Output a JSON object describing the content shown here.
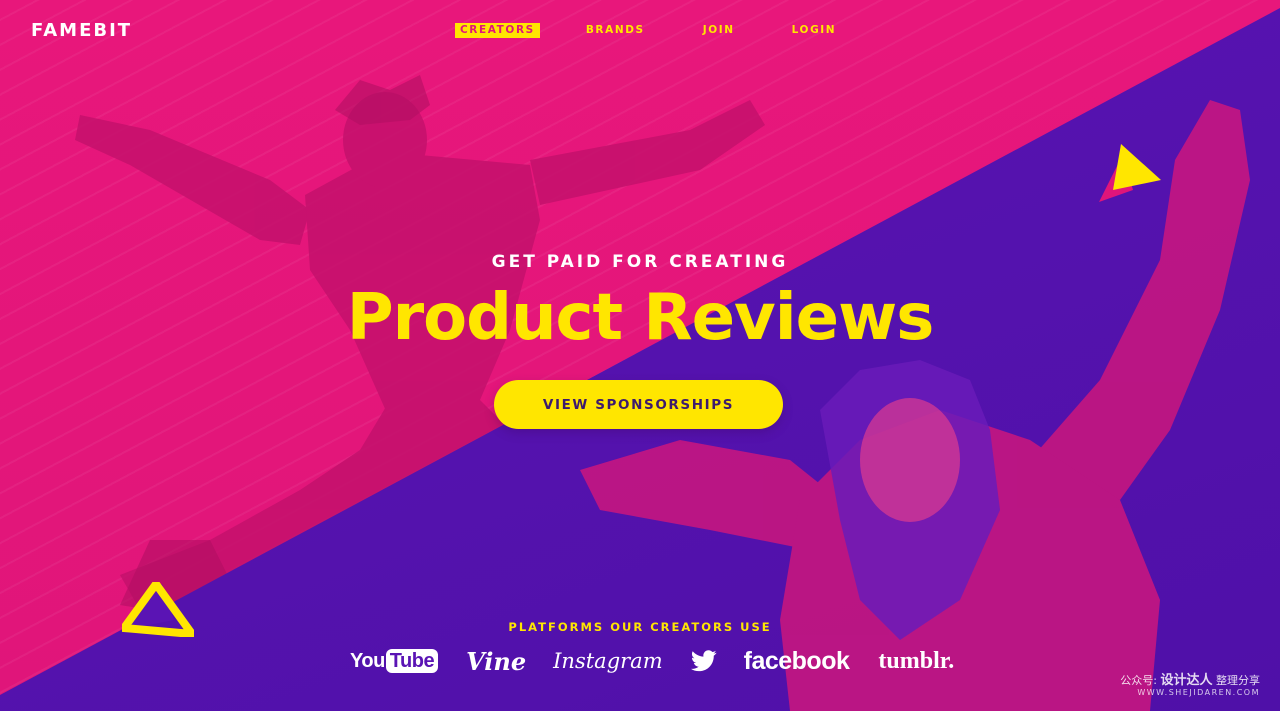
{
  "brand": {
    "logo_text": "FAMEBIT"
  },
  "nav": {
    "items": [
      {
        "label": "CREATORS",
        "active": true
      },
      {
        "label": "BRANDS",
        "active": false
      },
      {
        "label": "JOIN",
        "active": false
      },
      {
        "label": "LOGIN",
        "active": false
      }
    ]
  },
  "hero": {
    "kicker": "GET PAID FOR CREATING",
    "headline": "Product Reviews",
    "cta_label": "VIEW SPONSORSHIPS"
  },
  "platforms": {
    "title": "PLATFORMS OUR CREATORS USE",
    "youtube_you": "You",
    "youtube_tube": "Tube",
    "vine": "Vine",
    "instagram": "Instagram",
    "twitter_icon": "twitter-bird-icon",
    "facebook": "facebook",
    "tumblr": "tumblr."
  },
  "watermark": {
    "line1_a": "公众号:",
    "line1_b": "设计达人",
    "line1_c": "整理分享",
    "line2": "WWW.SHEJIDAREN.COM"
  },
  "colors": {
    "pink": "#e0157a",
    "purple": "#5a14b4",
    "yellow": "#ffe600",
    "white": "#ffffff"
  }
}
